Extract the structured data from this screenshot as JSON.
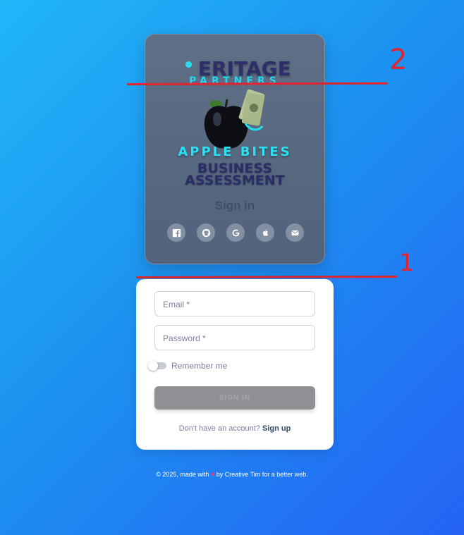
{
  "brand": {
    "logo_top": "MERITAGE",
    "logo_top_visible": "ERITAGE",
    "logo_sub": "PARTNERS",
    "title": "APPLE BITES",
    "line1": "BUSINESS",
    "line2": "ASSESSMENT"
  },
  "hero": {
    "sign_in_title": "Sign in",
    "social": [
      {
        "name": "facebook-icon"
      },
      {
        "name": "github-icon"
      },
      {
        "name": "google-icon"
      },
      {
        "name": "apple-icon"
      },
      {
        "name": "email-icon"
      }
    ]
  },
  "annotations": {
    "label_1": "1",
    "label_2": "2",
    "color": "#e0252e"
  },
  "form": {
    "email_label": "Email *",
    "password_label": "Password *",
    "remember_label": "Remember me",
    "remember_on": false,
    "submit_label": "SIGN IN",
    "signup_prompt": "Don't have an account?",
    "signup_link": "Sign up"
  },
  "footer": {
    "prefix": "© 2025, made with",
    "heart": "♥",
    "suffix": "by Creative Tim for a better web."
  },
  "colors": {
    "accent_cyan": "#23e0f2",
    "brand_navy": "#2e2f68",
    "background_from": "#21b6f8",
    "background_to": "#2563f5"
  }
}
